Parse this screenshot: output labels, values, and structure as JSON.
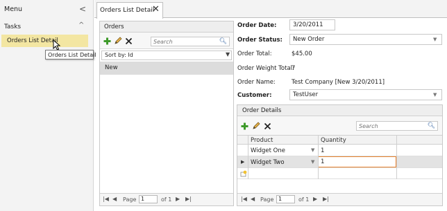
{
  "menu": {
    "title": "Menu",
    "collapse_glyph": "<",
    "section_label": "Tasks",
    "section_glyph": "^",
    "items": [
      {
        "label": "Orders List Detail"
      }
    ],
    "tooltip": "Orders List Detail"
  },
  "tabs": [
    {
      "label": "Orders List Detail",
      "close_glyph": "✕"
    }
  ],
  "orders_list": {
    "title": "Orders",
    "search_placeholder": "Search",
    "sort_label": "Sort by: Id",
    "rows": [
      {
        "label": "New"
      }
    ],
    "pager": {
      "page_label": "Page",
      "page_value": "1",
      "of_label": "of 1"
    }
  },
  "order_detail": {
    "order_date": {
      "label": "Order Date:",
      "value": "3/20/2011"
    },
    "order_status": {
      "label": "Order Status:",
      "value": "New Order"
    },
    "order_total": {
      "label": "Order Total:",
      "value": "$45.00"
    },
    "order_weight_total": {
      "label": "Order Weight Total:",
      "value": "7"
    },
    "order_name": {
      "label": "Order Name:",
      "value": "Test Company [New 3/20/2011]"
    },
    "customer": {
      "label": "Customer:",
      "value": "TestUser"
    }
  },
  "order_details": {
    "title": "Order Details",
    "search_placeholder": "Search",
    "columns": [
      "Product",
      "Quantity"
    ],
    "rows": [
      {
        "product": "Widget One",
        "quantity": "1"
      },
      {
        "product": "Widget Two",
        "quantity": "1"
      }
    ],
    "pager": {
      "page_label": "Page",
      "page_value": "1",
      "of_label": "of 1"
    }
  },
  "colors": {
    "selected_task_bg": "#f3e6a2",
    "editing_cell_border": "#e8822e",
    "add_icon": "#3e9a2a",
    "search_icon": "#2a5d9e"
  },
  "icons": [
    "chevron-left-icon",
    "chevron-up-icon",
    "close-icon",
    "add-icon",
    "edit-icon",
    "delete-icon",
    "search-icon",
    "dropdown-arrow-icon",
    "first-page-icon",
    "prev-page-icon",
    "next-page-icon",
    "last-page-icon",
    "row-pointer-icon",
    "new-row-icon",
    "mouse-cursor-icon"
  ]
}
